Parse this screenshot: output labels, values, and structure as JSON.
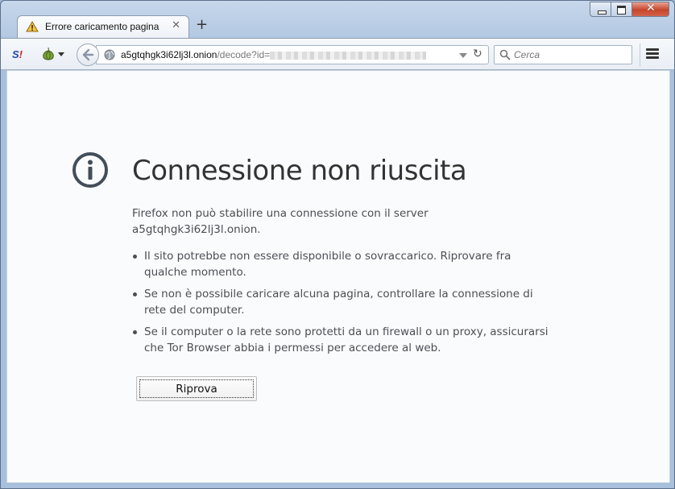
{
  "tab": {
    "title": "Errore caricamento pagina",
    "icon": "warning-icon"
  },
  "toolbar": {
    "url_host": "a5gtqhgk3i62lj3l.onion",
    "url_path": "/decode?id=",
    "search_placeholder": "Cerca"
  },
  "error": {
    "title": "Connessione non riuscita",
    "description": "Firefox non può stabilire una connessione con il server a5gtqhgk3i62lj3l.onion.",
    "reasons": [
      "Il sito potrebbe non essere disponibile o sovraccarico. Riprovare fra qualche momento.",
      "Se non è possibile caricare alcuna pagina, controllare la connessione di rete del computer.",
      "Se il computer o la rete sono protetti da un firewall o un proxy, assicurarsi che Tor Browser abbia i permessi per accedere al web."
    ],
    "retry_label": "Riprova"
  },
  "colors": {
    "accent": "#424e5a",
    "chrome": "#b3c8e2",
    "close_button": "#c6452b"
  }
}
